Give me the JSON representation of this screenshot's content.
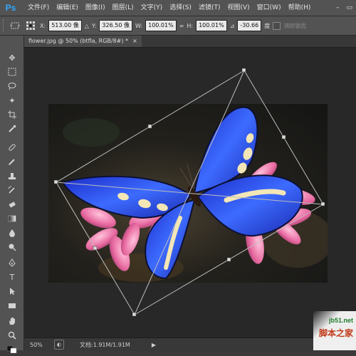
{
  "app": {
    "logo": "Ps"
  },
  "menu": [
    "文件(F)",
    "编辑(E)",
    "图像(I)",
    "图层(L)",
    "文字(Y)",
    "选择(S)",
    "滤镜(T)",
    "视图(V)",
    "窗口(W)",
    "帮助(H)"
  ],
  "window_controls": [
    "–",
    "▭"
  ],
  "options": {
    "x_label": "X:",
    "x_value": "513.00 像",
    "y_label": "Y:",
    "y_value": "326.50 像",
    "w_label": "W:",
    "w_value": "100.01%",
    "h_label": "H:",
    "h_value": "100.01%",
    "angle_value": "-30.66",
    "angle_unit": "度",
    "antialias_label": "消除锯齿"
  },
  "document": {
    "tab_title": "flower.jpg @ 50% (btfla, RGB/8#) *",
    "tab_close": "×"
  },
  "status": {
    "zoom": "50%",
    "doc_info": "文档:1.91M/1.91M",
    "arrow": "▶"
  },
  "watermark": {
    "site": "jb51.net",
    "name": "脚本之家"
  },
  "colors": {
    "menubar": "#535353",
    "canvas_bg": "#282828",
    "butterfly_blue": "#1f3fe0",
    "flower_pink": "#e86aa0",
    "ps_logo": "#31a8ff"
  }
}
